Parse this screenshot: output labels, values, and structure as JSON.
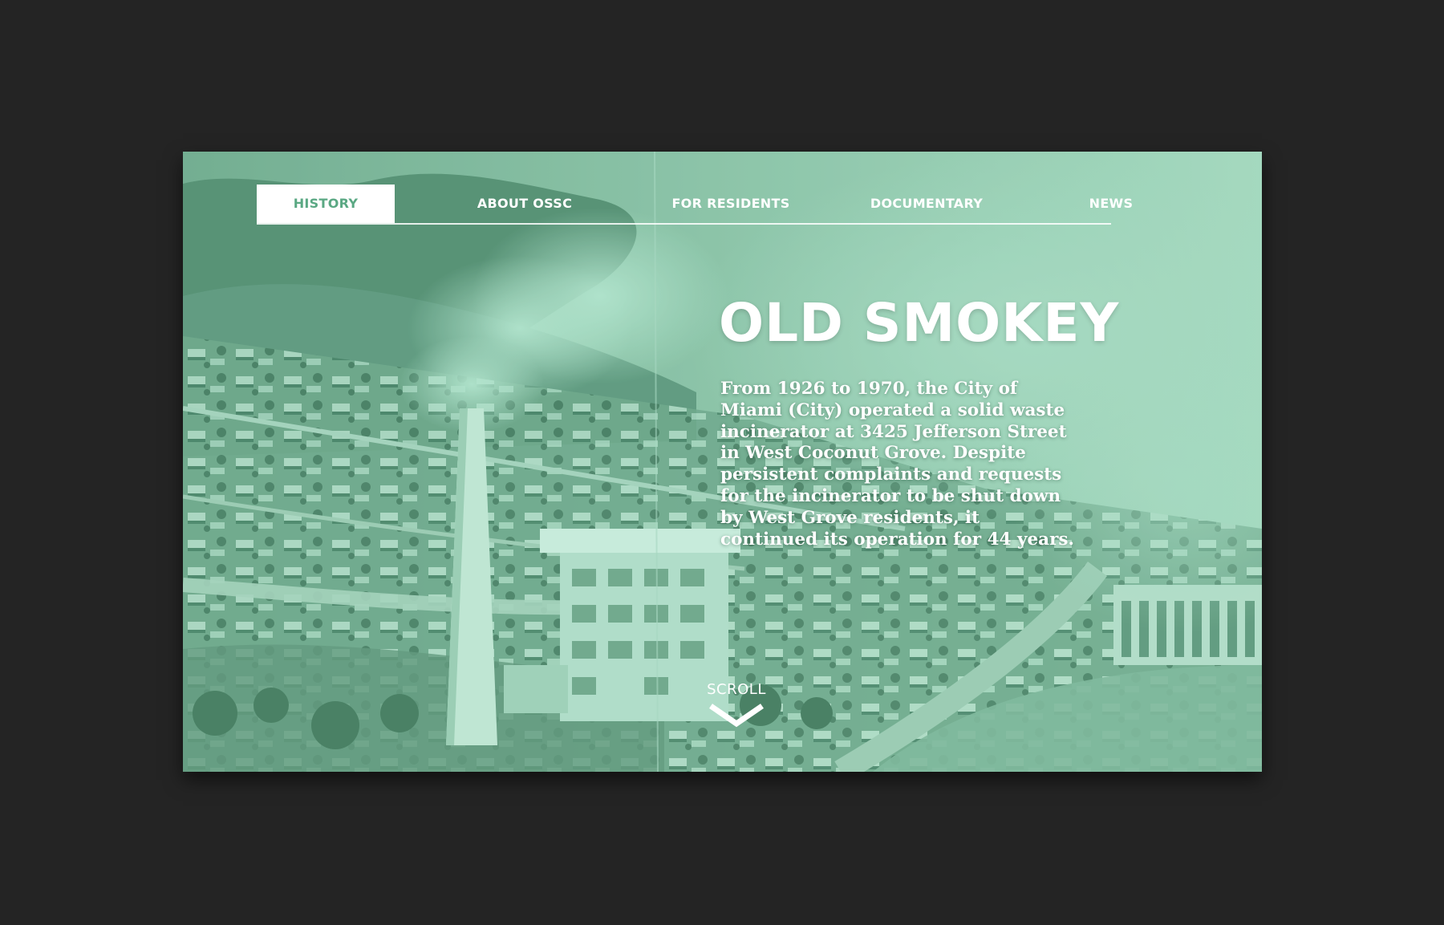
{
  "nav": {
    "items": [
      {
        "label": "HISTORY",
        "active": true
      },
      {
        "label": "ABOUT OSSC",
        "active": false
      },
      {
        "label": "FOR RESIDENTS",
        "active": false
      },
      {
        "label": "DOCUMENTARY",
        "active": false
      },
      {
        "label": "NEWS",
        "active": false
      }
    ]
  },
  "hero": {
    "title": "OLD SMOKEY",
    "body": "From 1926 to 1970, the City of Miami (City) operated a solid waste incinerator at 3425 Jefferson Street in West Coconut Grove. Despite persistent complaints and requests for the incinerator to be shut down by West Grove residents, it continued its operation for 44 years."
  },
  "scroll": {
    "label": "SCROLL",
    "icon": "chevron-down-icon"
  },
  "colors": {
    "background": "#242424",
    "accent": "#5aa883",
    "photo_tint": "#8fc5aa",
    "text": "#ffffff"
  }
}
